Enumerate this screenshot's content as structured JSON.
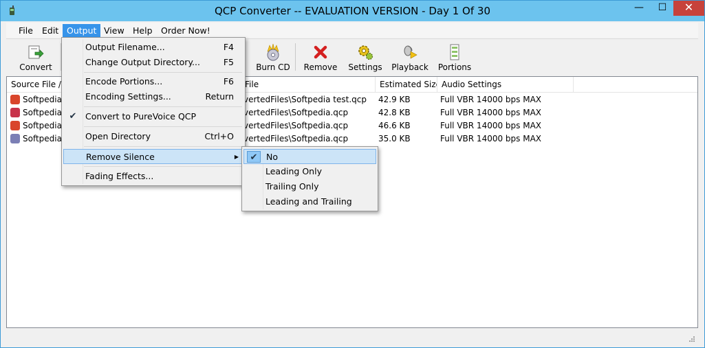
{
  "window": {
    "title": "QCP Converter -- EVALUATION VERSION - Day 1 Of 30",
    "minimize_glyph": "—",
    "maximize_glyph": "☐",
    "close_glyph": "✕"
  },
  "menubar": [
    "File",
    "Edit",
    "Output",
    "View",
    "Help",
    "Order Now!"
  ],
  "toolbar": [
    {
      "label": "Convert",
      "icon": "convert-icon"
    },
    {
      "label": "Burn CD",
      "icon": "burn-cd-icon"
    },
    {
      "label": "Remove",
      "icon": "remove-icon"
    },
    {
      "label": "Settings",
      "icon": "settings-icon"
    },
    {
      "label": "Playback",
      "icon": "playback-icon"
    },
    {
      "label": "Portions",
      "icon": "portions-icon"
    }
  ],
  "list": {
    "columns": [
      "Source File / T",
      "File",
      "Estimated Size",
      "Audio Settings"
    ],
    "rows": [
      {
        "source": "Softpedia t",
        "file": "vertedFiles\\Softpedia test.qcp",
        "size": "42.9 KB",
        "audio": "Full VBR 14000 bps MAX",
        "icon_color": "#d9452b"
      },
      {
        "source": "Softpedia.a",
        "file": "vertedFiles\\Softpedia.qcp",
        "size": "42.8 KB",
        "audio": "Full VBR 14000 bps MAX",
        "icon_color": "#c8334a"
      },
      {
        "source": "Softpedia.n",
        "file": "vertedFiles\\Softpedia.qcp",
        "size": "46.6 KB",
        "audio": "Full VBR 14000 bps MAX",
        "icon_color": "#d9452b"
      },
      {
        "source": "Softpedia.v",
        "file": "vertedFiles\\Softpedia.qcp",
        "size": "35.0 KB",
        "audio": "Full VBR 14000 bps MAX",
        "icon_color": "#7b7fb5"
      }
    ]
  },
  "output_menu": {
    "items": [
      {
        "label": "Output Filename...",
        "shortcut": "F4"
      },
      {
        "label": "Change Output Directory...",
        "shortcut": "F5"
      },
      {
        "label": "Encode Portions...",
        "shortcut": "F6"
      },
      {
        "label": "Encoding Settings...",
        "shortcut": "Return"
      },
      {
        "label": "Convert to PureVoice QCP",
        "shortcut": ""
      },
      {
        "label": "Open Directory",
        "shortcut": "Ctrl+O"
      },
      {
        "label": "Remove Silence",
        "shortcut": ""
      },
      {
        "label": "Fading Effects...",
        "shortcut": ""
      }
    ],
    "checked": "Convert to PureVoice QCP",
    "highlighted": "Remove Silence"
  },
  "remove_silence_submenu": {
    "items": [
      "No",
      "Leading Only",
      "Trailing Only",
      "Leading and Trailing"
    ],
    "selected": "No"
  },
  "colors": {
    "title_bar": "#6cc3ee",
    "menu_active": "#3794ea",
    "close_button": "#c7423b",
    "highlight": "#cce4f7"
  }
}
